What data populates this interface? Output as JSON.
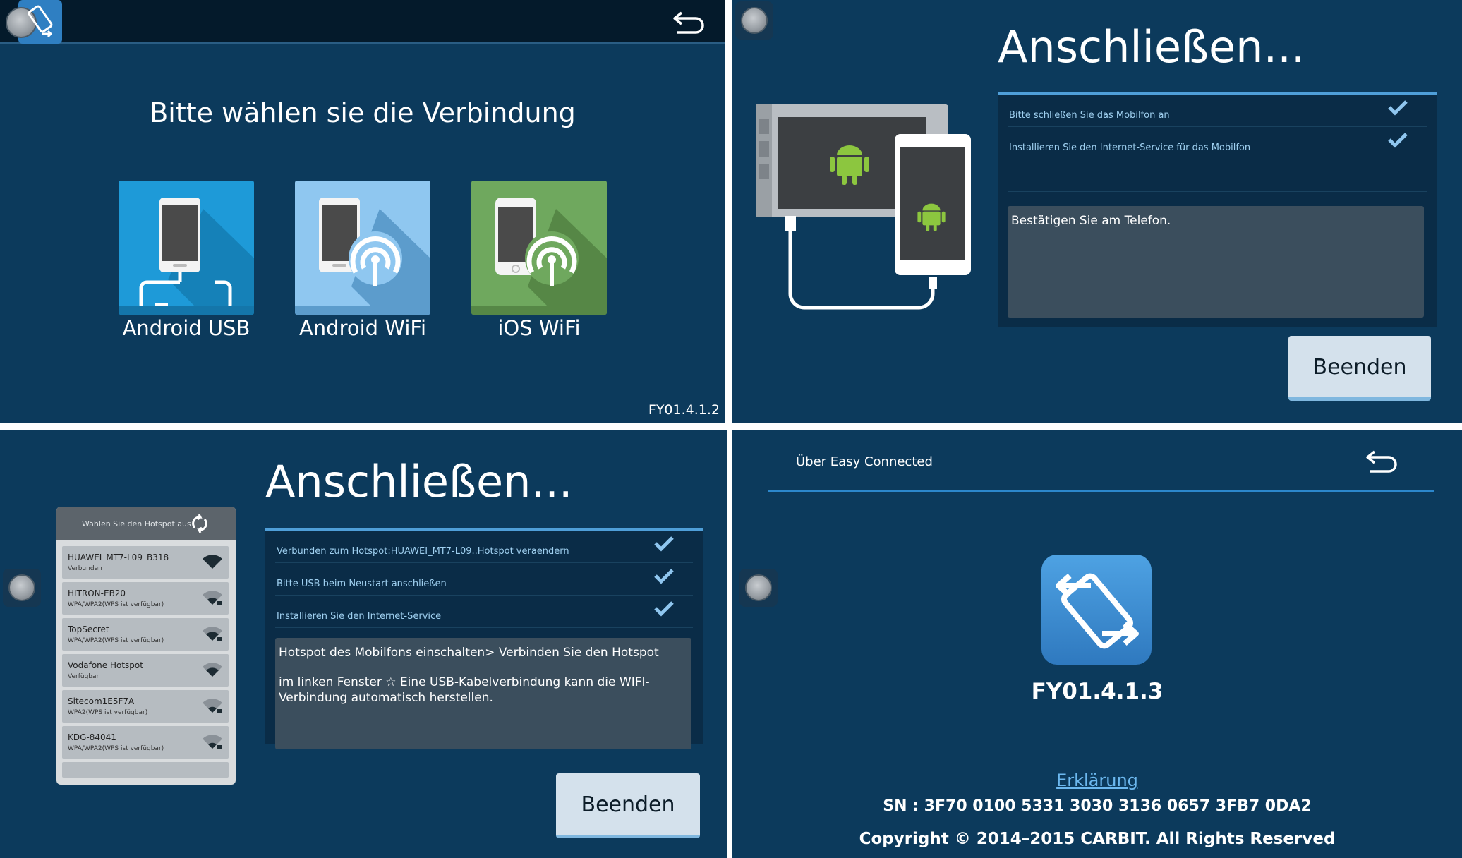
{
  "screen1": {
    "title": "Bitte wählen sie die Verbindung",
    "options": [
      {
        "label": "Android USB",
        "color": "#1e9ad8"
      },
      {
        "label": "Android WiFi",
        "color": "#8fc7f0"
      },
      {
        "label": "iOS WiFi",
        "color": "#6fa85e"
      }
    ],
    "version": "FY01.4.1.2"
  },
  "screen2": {
    "title": "Anschließen...",
    "steps": [
      {
        "text": "Bitte schließen Sie das Mobilfon an",
        "done": true
      },
      {
        "text": "Installieren Sie den Internet-Service für das Mobilfon",
        "done": true
      },
      {
        "text": "",
        "done": false
      }
    ],
    "message": "Bestätigen Sie am Telefon.",
    "finish_label": "Beenden"
  },
  "screen3": {
    "title": "Anschließen...",
    "hotspot_header": "Wählen Sie den Hotspot aus",
    "hotspots": [
      {
        "name": "HUAWEI_MT7-L09_B318",
        "status": "Verbunden"
      },
      {
        "name": "HITRON-EB20",
        "status": "WPA/WPA2(WPS ist verfügbar)"
      },
      {
        "name": "TopSecret",
        "status": "WPA/WPA2(WPS ist verfügbar)"
      },
      {
        "name": "Vodafone Hotspot",
        "status": "Verfügbar"
      },
      {
        "name": "Sitecom1E5F7A",
        "status": "WPA2(WPS ist verfügbar)"
      },
      {
        "name": "KDG-84041",
        "status": "WPA/WPA2(WPS ist verfügbar)"
      }
    ],
    "steps": [
      {
        "text": "Verbunden zum Hotspot:HUAWEI_MT7-L09..Hotspot veraendern",
        "done": true
      },
      {
        "text": "Bitte USB beim Neustart anschließen",
        "done": true
      },
      {
        "text": "Installieren Sie den Internet-Service",
        "done": true
      }
    ],
    "message_line1": "Hotspot des Mobilfons einschalten> Verbinden Sie den Hotspot",
    "message_line2": " im linken Fenster ☆ Eine USB-Kabelverbindung kann die WIFI-Verbindung automatisch herstellen.",
    "finish_label": "Beenden"
  },
  "screen4": {
    "about_title": "Über Easy Connected",
    "version": "FY01.4.1.3",
    "link_label": "Erklärung",
    "serial": "SN : 3F70 0100 5331 3030 3136 0657 3FB7 0DA2",
    "copyright": "Copyright © 2014–2015 CARBIT. All Rights Reserved"
  }
}
